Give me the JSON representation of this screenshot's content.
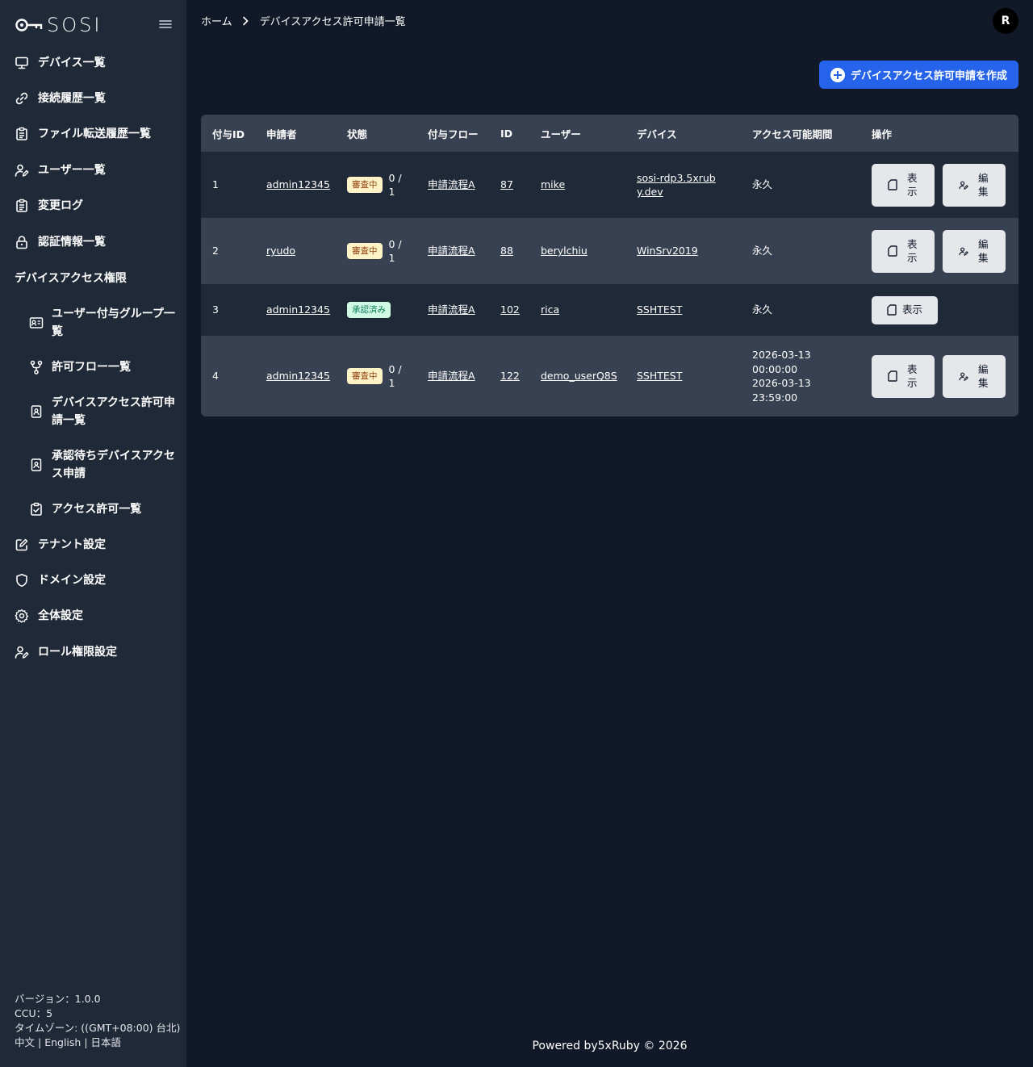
{
  "app": {
    "logo_text": "SOSI"
  },
  "sidebar": {
    "items": [
      {
        "label": "デバイス一覧",
        "icon": "monitor-icon"
      },
      {
        "label": "接続履歴一覧",
        "icon": "link-icon"
      },
      {
        "label": "ファイル転送履歴一覧",
        "icon": "clipboard-icon"
      },
      {
        "label": "ユーザー一覧",
        "icon": "user-edit-icon"
      },
      {
        "label": "変更ログ",
        "icon": "clipboard-icon"
      },
      {
        "label": "認証情報一覧",
        "icon": "lock-icon"
      }
    ],
    "section_label": "デバイスアクセス権限",
    "sub_items": [
      {
        "label": "ユーザー付与グループ一覧",
        "icon": "id-card-icon"
      },
      {
        "label": "許可フロー一覧",
        "icon": "flow-icon"
      },
      {
        "label": "デバイスアクセス許可申請一覧",
        "icon": "badge-icon"
      },
      {
        "label": "承認待ちデバイスアクセス申請",
        "icon": "badge-icon"
      },
      {
        "label": "アクセス許可一覧",
        "icon": "clipboard-check-icon"
      }
    ],
    "bottom_items": [
      {
        "label": "テナント設定",
        "icon": "edit-icon"
      },
      {
        "label": "ドメイン設定",
        "icon": "shield-icon"
      },
      {
        "label": "全体設定",
        "icon": "gear-icon"
      },
      {
        "label": "ロール権限設定",
        "icon": "user-edit-icon"
      }
    ],
    "footer": {
      "version": "バージョン：1.0.0",
      "ccu": "CCU：5",
      "timezone": "タイムゾーン: ((GMT+08:00) 台北)",
      "lang_zh": "中文",
      "lang_en": "English",
      "lang_ja": "日本語",
      "lang_sep": "|"
    }
  },
  "header": {
    "breadcrumb_home": "ホーム",
    "breadcrumb_current": "デバイスアクセス許可申請一覧",
    "avatar_initial": "R"
  },
  "create_button_label": "デバイスアクセス許可申請を作成",
  "table": {
    "headers": [
      "付与ID",
      "申請者",
      "状態",
      "付与フロー",
      "ID",
      "ユーザー",
      "デバイス",
      "アクセス可能期間",
      "操作"
    ],
    "rows": [
      {
        "grant_id": "1",
        "applicant": "admin12345",
        "status": "審査中",
        "status_type": "pending",
        "progress": "0 / 1",
        "flow": "申請流程A",
        "id": "87",
        "user": "mike",
        "device": "sosi-rdp3.5xruby.dev",
        "period": "永久",
        "view_label": "表示",
        "edit_label": "編集"
      },
      {
        "grant_id": "2",
        "applicant": "ryudo",
        "status": "審査中",
        "status_type": "pending",
        "progress": "0 / 1",
        "flow": "申請流程A",
        "id": "88",
        "user": "berylchiu",
        "device": "WinSrv2019",
        "period": "永久",
        "view_label": "表示",
        "edit_label": "編集"
      },
      {
        "grant_id": "3",
        "applicant": "admin12345",
        "status": "承認済み",
        "status_type": "approved",
        "progress": "",
        "flow": "申請流程A",
        "id": "102",
        "user": "rica",
        "device": "SSHTEST",
        "period": "永久",
        "view_label": "表示",
        "edit_label": ""
      },
      {
        "grant_id": "4",
        "applicant": "admin12345",
        "status": "審査中",
        "status_type": "pending",
        "progress": "0 / 1",
        "flow": "申請流程A",
        "id": "122",
        "user": "demo_userQ8S",
        "device": "SSHTEST",
        "period": "2026-03-13 00:00:00 2026-03-13 23:59:00",
        "view_label": "表示",
        "edit_label": "編集"
      }
    ]
  },
  "footer_text": "Powered by5xRuby © 2026"
}
